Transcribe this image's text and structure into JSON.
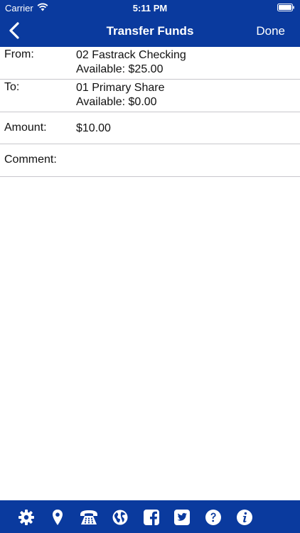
{
  "status_bar": {
    "carrier": "Carrier",
    "time": "5:11 PM"
  },
  "nav": {
    "title": "Transfer Funds",
    "done_label": "Done",
    "back_icon": "chevron-left-icon"
  },
  "form": {
    "from": {
      "label": "From:",
      "account": "02 Fastrack Checking",
      "available": "Available: $25.00"
    },
    "to": {
      "label": "To:",
      "account": "01 Primary Share",
      "available": "Available: $0.00"
    },
    "amount": {
      "label": "Amount:",
      "value": "$10.00"
    },
    "comment": {
      "label": "Comment:",
      "value": ""
    }
  },
  "footer_icons": [
    "gear-icon",
    "location-pin-icon",
    "phone-icon",
    "globe-icon",
    "facebook-icon",
    "twitter-icon",
    "help-icon",
    "info-icon"
  ],
  "colors": {
    "brand_blue": "#0a3a9e",
    "divider": "#c8c7cc"
  }
}
